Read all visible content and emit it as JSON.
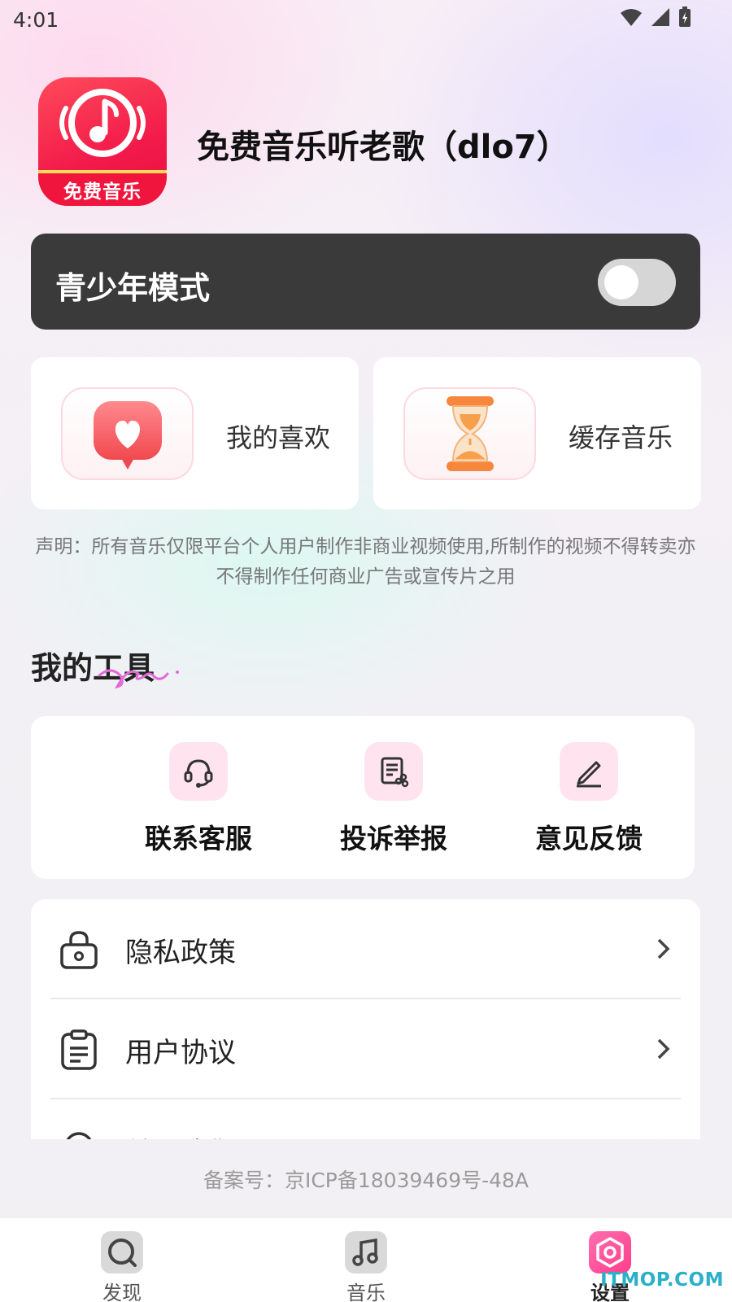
{
  "status_bar": {
    "time": "4:01"
  },
  "header": {
    "app_title": "免费音乐听老歌（dlo7）",
    "logo_text": "免费音乐"
  },
  "teen_mode": {
    "label": "青少年模式",
    "enabled": false
  },
  "quick_cards": [
    {
      "label": "我的喜欢",
      "icon": "heart-icon"
    },
    {
      "label": "缓存音乐",
      "icon": "hourglass-icon"
    }
  ],
  "notice": "声明：所有音乐仅限平台个人用户制作非商业视频使用,所制作的视频不得转卖亦不得制作任何商业广告或宣传片之用",
  "tools": {
    "title": "我的工具",
    "items": [
      {
        "label": "联系客服",
        "icon": "headset-icon"
      },
      {
        "label": "投诉举报",
        "icon": "report-icon"
      },
      {
        "label": "意见反馈",
        "icon": "edit-icon"
      }
    ]
  },
  "settings": [
    {
      "label": "隐私政策",
      "icon": "lock-icon"
    },
    {
      "label": "用户协议",
      "icon": "clipboard-icon"
    },
    {
      "label": "关于我们",
      "icon": "info-icon"
    }
  ],
  "icp": "备案号：京ICP备18039469号-48A",
  "bottom_nav": [
    {
      "label": "发现",
      "icon": "discover-icon"
    },
    {
      "label": "音乐",
      "icon": "music-note-icon"
    },
    {
      "label": "设置",
      "icon": "settings-icon",
      "active": true
    }
  ],
  "watermark": "ITMOP.COM",
  "colors": {
    "accent": "#ff4d8d",
    "dark_card": "#3a3a3a",
    "tool_icon_bg": "#ffe4ef"
  }
}
